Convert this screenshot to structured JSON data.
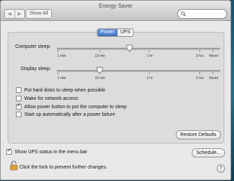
{
  "window": {
    "title": "Energy Saver",
    "show_all_label": "Show All",
    "back_icon": "chevron-left-icon",
    "forward_icon": "chevron-right-icon",
    "search": {
      "value": "",
      "icon": "search-icon"
    }
  },
  "tabs": [
    {
      "label": "Power",
      "selected": true
    },
    {
      "label": "UPS",
      "selected": false
    }
  ],
  "computer_sleep": {
    "label": "Computer sleep:",
    "tick_labels": [
      "1 min",
      "15 min",
      "1 hr",
      "3 hrs",
      "Never"
    ]
  },
  "display_sleep": {
    "label": "Display sleep:",
    "tick_labels": [
      "1 min",
      "15 min",
      "1 hr",
      "3 hrs",
      "Never"
    ]
  },
  "options": [
    {
      "label": "Put hard disks to sleep when possible",
      "checked": false
    },
    {
      "label": "Wake for network access",
      "checked": false
    },
    {
      "label": "Allow power button to put the computer to sleep",
      "checked": true
    },
    {
      "label": "Start up automatically after a power failure",
      "checked": false
    }
  ],
  "restore_defaults_label": "Restore Defaults",
  "show_ups_status": {
    "label": "Show UPS status in the menu bar",
    "checked": true
  },
  "schedule_label": "Schedule...",
  "lock": {
    "text": "Click the lock to prevent further changes.",
    "icon": "lock-icon"
  },
  "help_label": "?",
  "colors": {
    "accent": "#3f72c6",
    "window_bg": "#e8e8e8",
    "panel_bg": "#dcdcdc"
  }
}
